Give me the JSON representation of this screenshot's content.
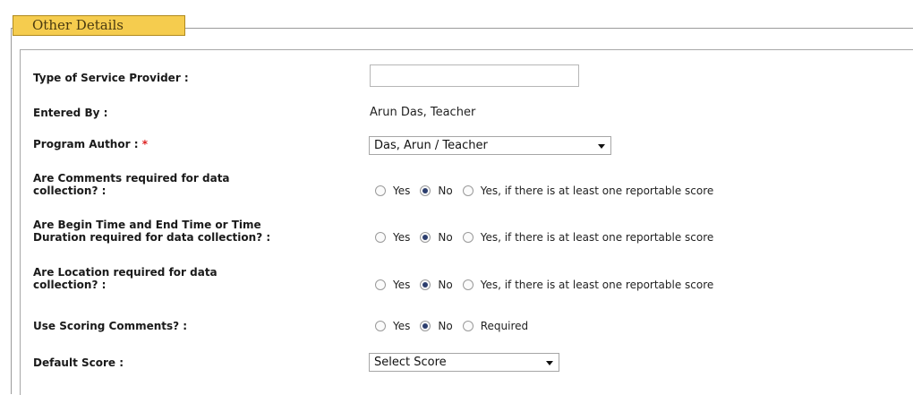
{
  "section": {
    "legend": "Other Details"
  },
  "fields": {
    "service_provider": {
      "label": "Type of Service Provider :",
      "value": ""
    },
    "entered_by": {
      "label": "Entered By :",
      "value": "Arun Das, Teacher"
    },
    "program_author": {
      "label": "Program Author :",
      "required_mark": "*",
      "selected": "Das, Arun / Teacher"
    },
    "comments_required": {
      "label_line1": "Are Comments required for data",
      "label_line2": "collection? :",
      "options": [
        "Yes",
        "No",
        "Yes, if there is at least one reportable score"
      ],
      "selected": "No"
    },
    "time_required": {
      "label_line1": "Are Begin Time and End Time or Time",
      "label_line2": "Duration required for data collection? :",
      "options": [
        "Yes",
        "No",
        "Yes, if there is at least one reportable score"
      ],
      "selected": "No"
    },
    "location_required": {
      "label_line1": "Are Location required for data",
      "label_line2": "collection? :",
      "options": [
        "Yes",
        "No",
        "Yes, if there is at least one reportable score"
      ],
      "selected": "No"
    },
    "scoring_comments": {
      "label": "Use Scoring Comments? :",
      "options": [
        "Yes",
        "No",
        "Required"
      ],
      "selected": "No"
    },
    "default_score": {
      "label": "Default Score :",
      "selected": "Select Score"
    }
  }
}
